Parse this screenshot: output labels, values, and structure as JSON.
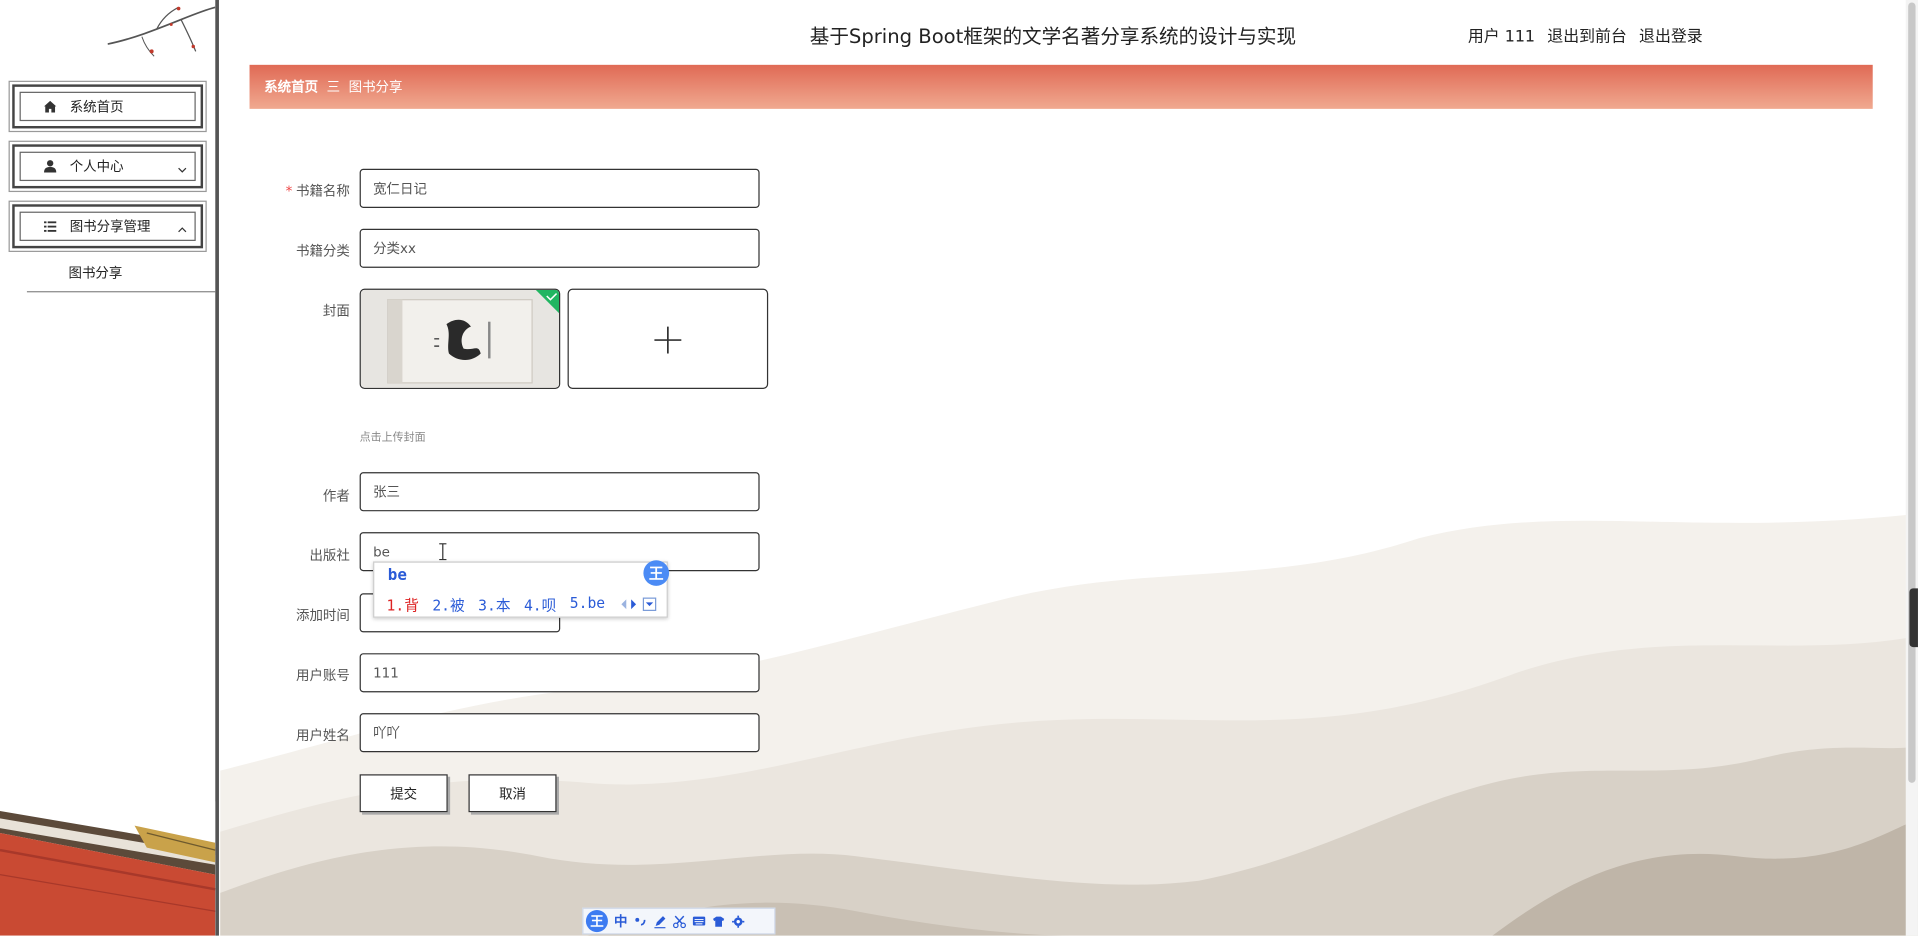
{
  "header": {
    "title": "基于Spring Boot框架的文学名著分享系统的设计与实现",
    "user_label": "用户 111",
    "to_front_label": "退出到前台",
    "logout_label": "退出登录"
  },
  "sidebar": {
    "items": [
      {
        "label": "系统首页",
        "icon": "home-icon"
      },
      {
        "label": "个人中心",
        "icon": "user-icon"
      },
      {
        "label": "图书分享管理",
        "icon": "list-icon"
      }
    ],
    "submenu_item": "图书分享"
  },
  "breadcrumb": {
    "home": "系统首页",
    "separator": "三",
    "current": "图书分享"
  },
  "form": {
    "book_name_label": "书籍名称",
    "book_name_value": "宽仁日记",
    "category_label": "书籍分类",
    "category_value": "分类xx",
    "cover_label": "封面",
    "cover_hint": "点击上传封面",
    "author_label": "作者",
    "author_value": "张三",
    "publisher_label": "出版社",
    "publisher_value": "be",
    "add_time_label": "添加时间",
    "account_label": "用户账号",
    "account_value": "111",
    "username_label": "用户姓名",
    "username_value": "吖吖",
    "submit_label": "提交",
    "cancel_label": "取消"
  },
  "ime": {
    "pinyin": "be",
    "candidates": [
      "1.背",
      "2.被",
      "3.本",
      "4.呗",
      "5.be"
    ],
    "logo": "王",
    "toolbar_mode": "中"
  },
  "colors": {
    "breadcrumb_start": "#e06a55",
    "breadcrumb_end": "#f0a990",
    "required": "#e44444",
    "ime_blue": "#2a5bd7",
    "upload_badge": "#21b561"
  }
}
